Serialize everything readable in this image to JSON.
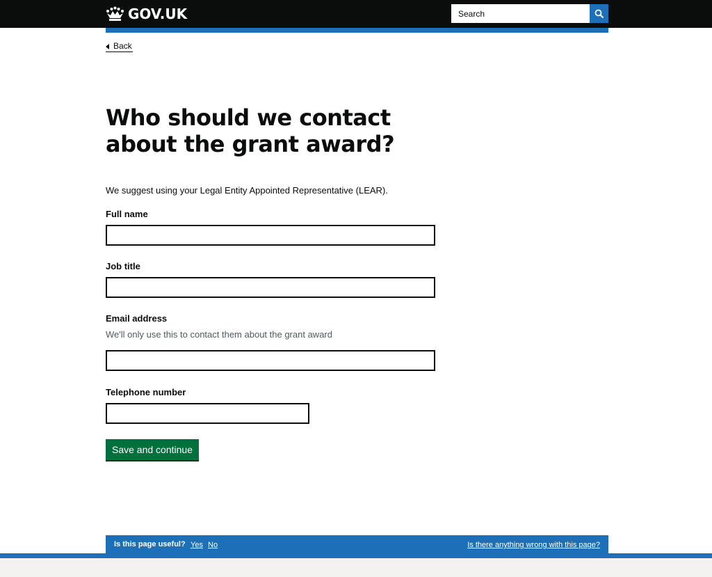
{
  "header": {
    "logo_text": "GOV.UK",
    "search_placeholder": "Search"
  },
  "nav": {
    "back_label": "Back"
  },
  "main": {
    "heading": "Who should we contact about the grant award?",
    "intro_hint": "We suggest using your Legal Entity Appointed Representative (LEAR).",
    "fields": [
      {
        "label": "Full name",
        "value": ""
      },
      {
        "label": "Job title",
        "value": ""
      },
      {
        "label": "Email address",
        "hint": "We'll only use this to contact them about the grant award",
        "value": ""
      },
      {
        "label": "Telephone number",
        "value": ""
      }
    ],
    "submit_label": "Save and continue"
  },
  "feedback": {
    "question": "Is this page useful?",
    "yes_label": "Yes",
    "no_label": "No",
    "report_label": "Is there anything wrong with this page?"
  },
  "colors": {
    "header_bg": "#0b0c0c",
    "accent_blue": "#1d70b8",
    "button_green": "#00703c",
    "footer_bg": "#f3f2f1"
  },
  "icons": {
    "logo": "crown-icon",
    "search": "magnifier-icon",
    "back": "triangle-left-icon"
  }
}
